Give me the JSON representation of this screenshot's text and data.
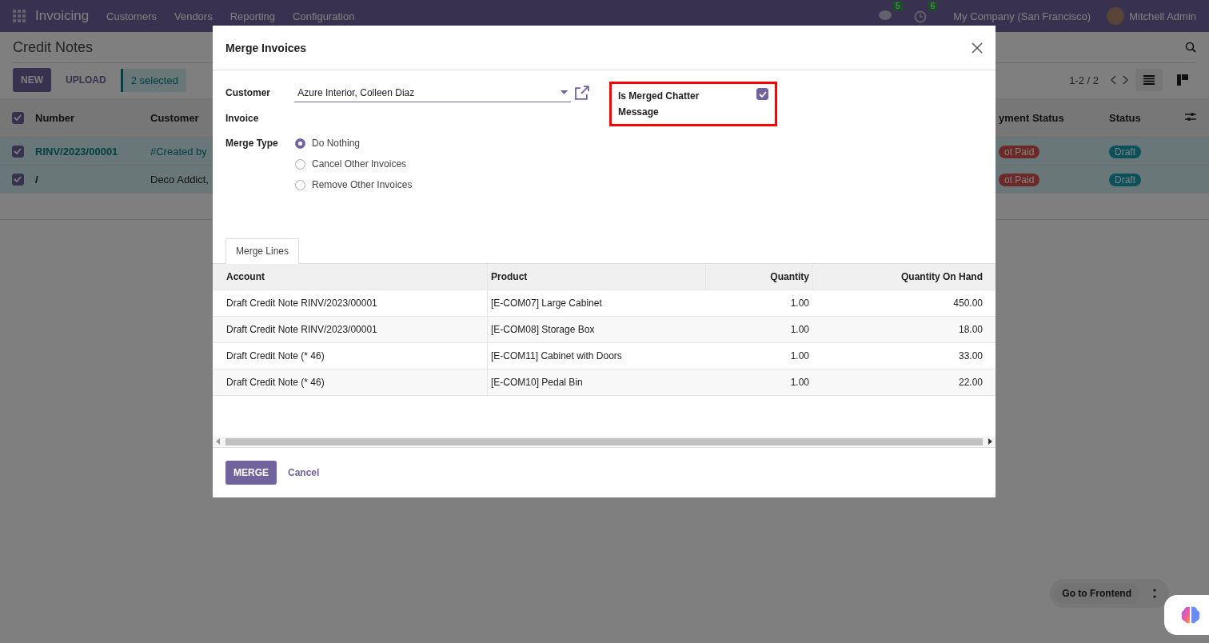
{
  "navbar": {
    "app": "Invoicing",
    "menu": [
      "Customers",
      "Vendors",
      "Reporting",
      "Configuration"
    ],
    "messages_count": "5",
    "activities_count": "6",
    "company": "My Company (San Francisco)",
    "user": "Mitchell Admin"
  },
  "page": {
    "title": "Credit Notes",
    "buttons": [
      {
        "label": "NEW",
        "kind": "primary"
      },
      {
        "label": "UPLOAD",
        "kind": "secondary"
      }
    ],
    "selection": "2 selected",
    "pager": "1-2 / 2"
  },
  "list": {
    "all_checked": true,
    "columns": [
      "Number",
      "Customer",
      "yment Status",
      "Status"
    ],
    "rows": [
      {
        "checked": true,
        "link": true,
        "number": "RINV/2023/00001",
        "customer": "#Created by",
        "payment_status": "ot Paid",
        "status": "Draft"
      },
      {
        "checked": true,
        "link": false,
        "number": "/",
        "customer": "Deco Addict,",
        "payment_status": "ot Paid",
        "status": "Draft"
      }
    ]
  },
  "dialog": {
    "title": "Merge Invoices",
    "customer_label": "Customer",
    "customer_value": "Azure Interior, Colleen Diaz",
    "invoice_label": "Invoice",
    "merge_type_label": "Merge Type",
    "merge_types": [
      {
        "label": "Do Nothing",
        "selected": true
      },
      {
        "label": "Cancel Other Invoices",
        "selected": false
      },
      {
        "label": "Remove Other Invoices",
        "selected": false
      }
    ],
    "chatter": {
      "label": "Is Merged Chatter Message",
      "checked": true,
      "highlighted": true
    },
    "tabs": [
      {
        "label": "Merge Lines",
        "selected": true
      }
    ],
    "columns": [
      "Account",
      "Product",
      "Quantity",
      "Quantity On Hand"
    ],
    "rows": [
      {
        "account": "Draft Credit Note RINV/2023/00001",
        "product": "[E-COM07] Large Cabinet",
        "quantity": "1.00",
        "on_hand": "450.00"
      },
      {
        "account": "Draft Credit Note RINV/2023/00001",
        "product": "[E-COM08] Storage Box",
        "quantity": "1.00",
        "on_hand": "18.00"
      },
      {
        "account": "Draft Credit Note (* 46)",
        "product": "[E-COM11] Cabinet with Doors",
        "quantity": "1.00",
        "on_hand": "33.00"
      },
      {
        "account": "Draft Credit Note (* 46)",
        "product": "[E-COM10] Pedal Bin",
        "quantity": "1.00",
        "on_hand": "22.00"
      }
    ],
    "buttons": [
      {
        "label": "MERGE",
        "kind": "primary"
      },
      {
        "label": "Cancel",
        "kind": "link"
      }
    ]
  },
  "floating": {
    "button": "Go to Frontend"
  }
}
